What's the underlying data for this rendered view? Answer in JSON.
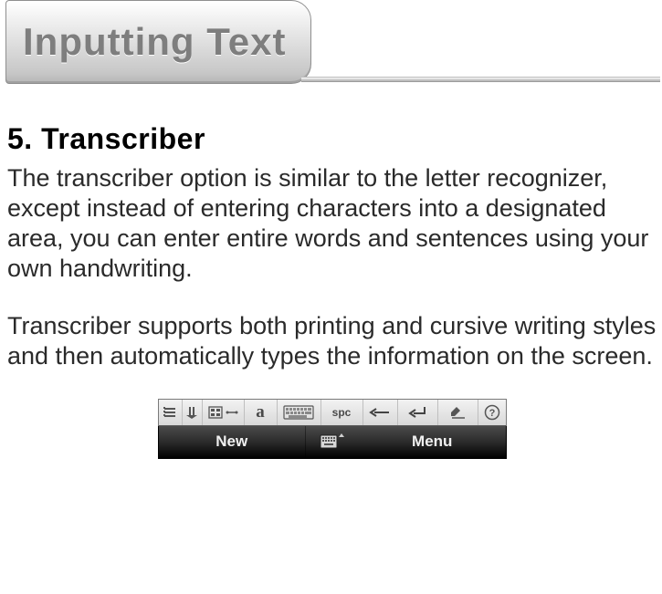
{
  "header": {
    "chapter_title": "Inputting Text"
  },
  "section": {
    "heading": "5. Transcriber",
    "paragraph_1": "The transcriber option is similar to the letter recognizer, except instead of entering characters into a designated area, you can enter entire words and sentences using your own handwriting.",
    "paragraph_2": "Transcriber supports both printing and cursive writing styles and then automatically types the information on the screen."
  },
  "toolbar": {
    "buttons": {
      "options": "options-icon",
      "writing_direction": "writing-direction-icon",
      "letter_shapes": "letter-shapes-icon",
      "recognition_mode": "a",
      "keyboard": "keyboard-icon",
      "space": "spc",
      "backspace": "backspace-icon",
      "enter": "enter-icon",
      "correction": "correction-icon",
      "help": "?"
    },
    "bottom": {
      "left": "New",
      "center": "sip-icon",
      "right": "Menu"
    }
  }
}
